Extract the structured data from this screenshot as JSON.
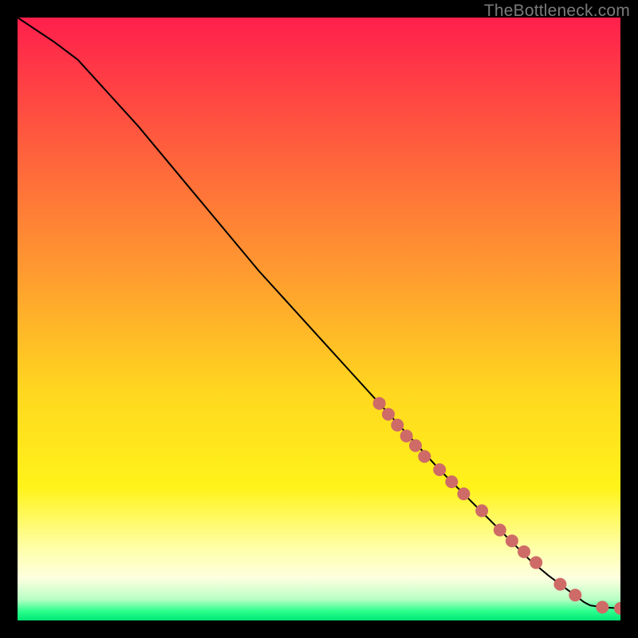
{
  "watermark": "TheBottleneck.com",
  "chart_data": {
    "type": "line",
    "title": "",
    "xlabel": "",
    "ylabel": "",
    "xlim": [
      0,
      100
    ],
    "ylim": [
      0,
      100
    ],
    "grid": false,
    "series": [
      {
        "name": "curve",
        "x": [
          0,
          3,
          6,
          10,
          15,
          20,
          25,
          30,
          35,
          40,
          45,
          50,
          55,
          60,
          65,
          70,
          75,
          80,
          85,
          88,
          90,
          92,
          94,
          95,
          97,
          100
        ],
        "y": [
          100,
          98,
          96,
          93,
          87.5,
          82,
          76,
          70,
          64,
          58,
          52.5,
          47,
          41.5,
          36,
          30.5,
          25,
          20,
          15,
          10,
          7.5,
          6,
          4.5,
          3,
          2.5,
          2.2,
          2
        ]
      }
    ],
    "markers": {
      "name": "highlighted-points",
      "color": "#cf6b66",
      "x": [
        60,
        61.5,
        63,
        64.5,
        66,
        67.5,
        70,
        72,
        74,
        77,
        80,
        82,
        84,
        86,
        90,
        92.5,
        97,
        100
      ],
      "y": [
        36,
        34.2,
        32.4,
        30.6,
        29,
        27.2,
        25,
        23,
        21,
        18.2,
        15,
        13.2,
        11.4,
        9.6,
        6,
        4.2,
        2.2,
        2
      ]
    },
    "background_gradient": {
      "stops": [
        {
          "offset": 0.0,
          "color": "#ff1f4c"
        },
        {
          "offset": 0.2,
          "color": "#ff5a3e"
        },
        {
          "offset": 0.42,
          "color": "#ff9a30"
        },
        {
          "offset": 0.62,
          "color": "#ffd71f"
        },
        {
          "offset": 0.78,
          "color": "#fff31a"
        },
        {
          "offset": 0.88,
          "color": "#ffffa8"
        },
        {
          "offset": 0.93,
          "color": "#fdffe0"
        },
        {
          "offset": 0.965,
          "color": "#b8ffc4"
        },
        {
          "offset": 0.985,
          "color": "#2aff8c"
        },
        {
          "offset": 1.0,
          "color": "#00e676"
        }
      ]
    }
  }
}
